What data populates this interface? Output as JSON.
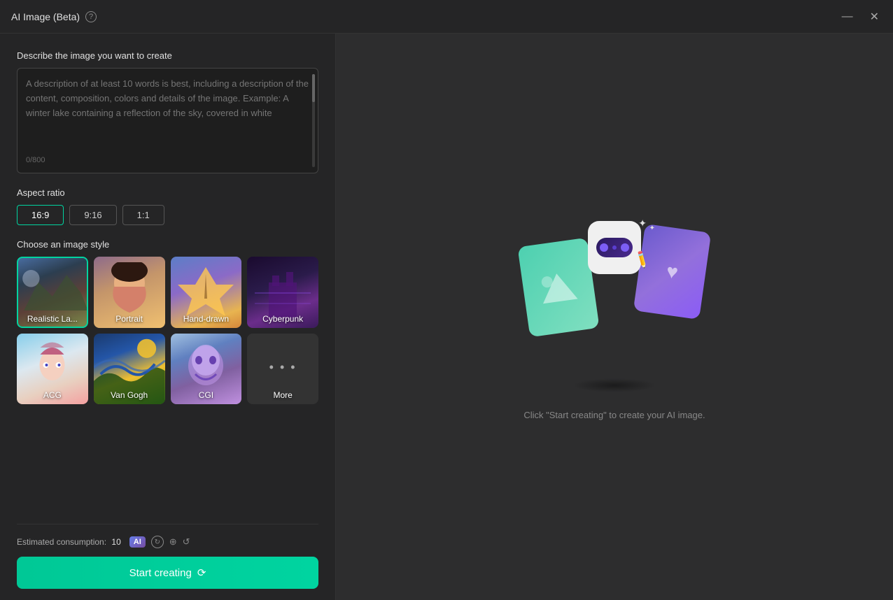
{
  "titleBar": {
    "title": "AI Image (Beta)",
    "helpTooltip": "Help",
    "minimizeLabel": "Minimize",
    "closeLabel": "Close"
  },
  "leftPanel": {
    "descriptionLabel": "Describe the image you want to create",
    "descriptionPlaceholder": "A description of at least 10 words is best, including a description of the content, composition, colors and details of the image. Example: A winter lake containing a reflection of the sky, covered in white",
    "charCount": "0/800",
    "aspectRatioLabel": "Aspect ratio",
    "ratioOptions": [
      {
        "value": "16:9",
        "active": true
      },
      {
        "value": "9:16",
        "active": false
      },
      {
        "value": "1:1",
        "active": false
      }
    ],
    "styleLabel": "Choose an image style",
    "styles": [
      {
        "id": "realistic",
        "label": "Realistic La...",
        "selected": true
      },
      {
        "id": "portrait",
        "label": "Portrait",
        "selected": false
      },
      {
        "id": "handdrawn",
        "label": "Hand-drawn",
        "selected": false
      },
      {
        "id": "cyberpunk",
        "label": "Cyberpunk",
        "selected": false
      },
      {
        "id": "acg",
        "label": "ACG",
        "selected": false
      },
      {
        "id": "vangogh",
        "label": "Van Gogh",
        "selected": false
      },
      {
        "id": "cgi",
        "label": "CGI",
        "selected": false
      },
      {
        "id": "more",
        "label": "More",
        "selected": false
      }
    ],
    "consumptionLabel": "Estimated consumption:",
    "consumptionValue": "10",
    "startBtnLabel": "Start creating",
    "startBtnIcon": "⟳"
  },
  "rightPanel": {
    "hintText": "Click \"Start creating\" to create your AI image."
  }
}
